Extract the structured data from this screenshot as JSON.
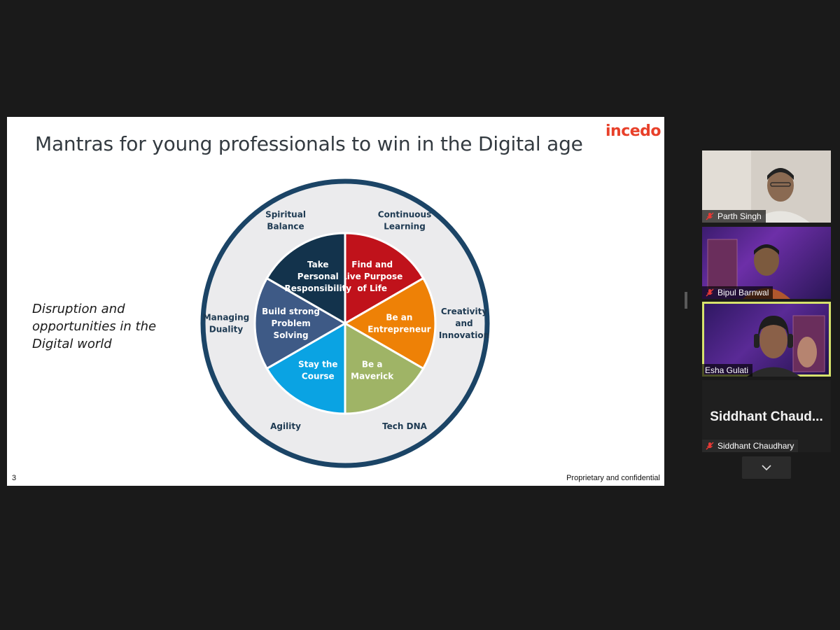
{
  "slide": {
    "title": "Mantras for young professionals to win in the Digital age",
    "brand": "incedo",
    "side_text": "Disruption and opportunities in the Digital world",
    "page_number": "3",
    "footer": "Proprietary and confidential",
    "wheel": {
      "segments": [
        {
          "lines": [
            "Find and",
            "Live Purpose",
            "of Life"
          ],
          "color": "#c0121b"
        },
        {
          "lines": [
            "Be an",
            "Entrepreneur"
          ],
          "color": "#ee8106"
        },
        {
          "lines": [
            "Be a",
            "Maverick"
          ],
          "color": "#9fb466"
        },
        {
          "lines": [
            "Stay the",
            "Course"
          ],
          "color": "#0aa3e3"
        },
        {
          "lines": [
            "Build strong",
            "Problem",
            "Solving"
          ],
          "color": "#3e5a86"
        },
        {
          "lines": [
            "Take",
            "Personal",
            "Responsibility"
          ],
          "color": "#13334c"
        }
      ],
      "outer_labels": [
        {
          "lines": [
            "Continuous",
            "Learning"
          ]
        },
        {
          "lines": [
            "Creativity",
            "and",
            "Innovation"
          ]
        },
        {
          "lines": [
            "Tech DNA"
          ]
        },
        {
          "lines": [
            "Agility"
          ]
        },
        {
          "lines": [
            "Managing",
            "Duality"
          ]
        },
        {
          "lines": [
            "Spiritual",
            "Balance"
          ]
        }
      ],
      "ring_color": "#1b4466",
      "ring_fill": "#ebebed"
    }
  },
  "participants": [
    {
      "name": "Parth Singh",
      "muted": true
    },
    {
      "name": "Bipul Barnwal",
      "muted": true
    },
    {
      "name": "Esha Gulati",
      "muted": false,
      "active_speaker": true
    },
    {
      "name": "Siddhant Chaudhary",
      "display_name": "Siddhant  Chaud...",
      "muted": true,
      "video_off": true
    }
  ],
  "icons": {
    "mic_off": "mic-off-icon",
    "scroll": "chevron-down-icon",
    "resize": "resize-handle-icon"
  }
}
